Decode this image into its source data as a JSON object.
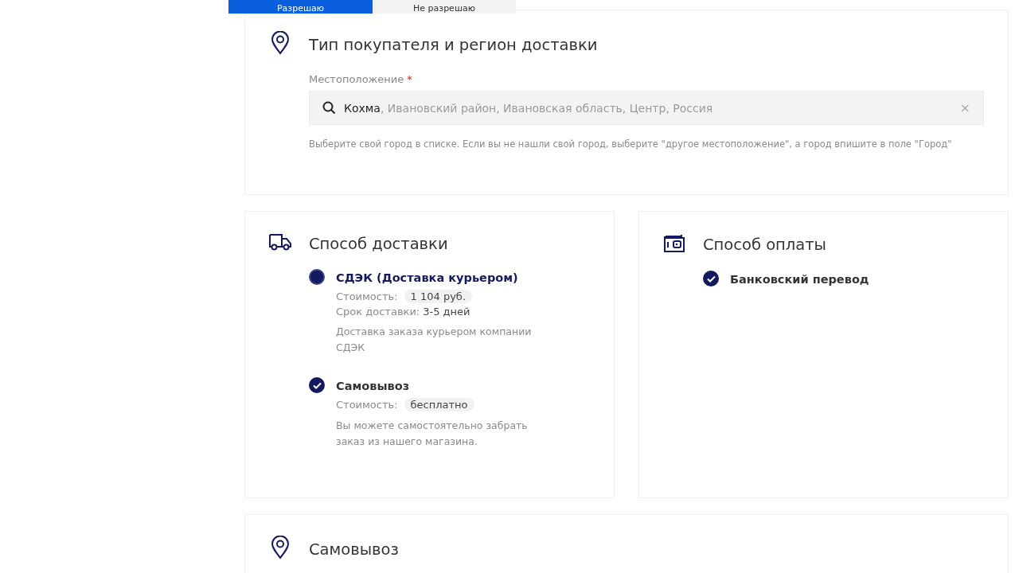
{
  "consent_buttons": [
    {
      "label": "Разрешаю",
      "kind": "primary"
    },
    {
      "label": "Не разрешаю",
      "kind": "secondary"
    }
  ],
  "buyer_section": {
    "title": "Тип покупателя и регион доставки",
    "location": {
      "label": "Местоположение",
      "required_mark": "*",
      "value": "Кохма",
      "suggestion": ", Ивановский район, Ивановская область, Центр, Россия",
      "clear": "×"
    },
    "hint": "Выберите свой город в списке. Если вы не нашли свой город, выберите \"другое местоположение\", а город впишите в поле \"Город\""
  },
  "delivery": {
    "title": "Способ доставки",
    "options": [
      {
        "name": "СДЭК (Доставка курьером)",
        "selected": false,
        "hovered": true,
        "price_label": "Стоимость:",
        "price": "1 104 руб.",
        "term_label": "Срок доставки:",
        "term_value": "3-5 дней",
        "description": "Доставка заказа курьером компании СДЭК"
      },
      {
        "name": "Самовывоз",
        "selected": true,
        "hovered": false,
        "price_label": "Стоимость:",
        "price": "бесплатно",
        "description": "Вы можете самостоятельно забрать заказ из нашего магазина."
      }
    ]
  },
  "payment": {
    "title": "Способ оплаты",
    "options": [
      {
        "name": "Банковский перевод",
        "selected": true,
        "hovered": false
      }
    ]
  },
  "pickup_section": {
    "title": "Самовывоз"
  }
}
